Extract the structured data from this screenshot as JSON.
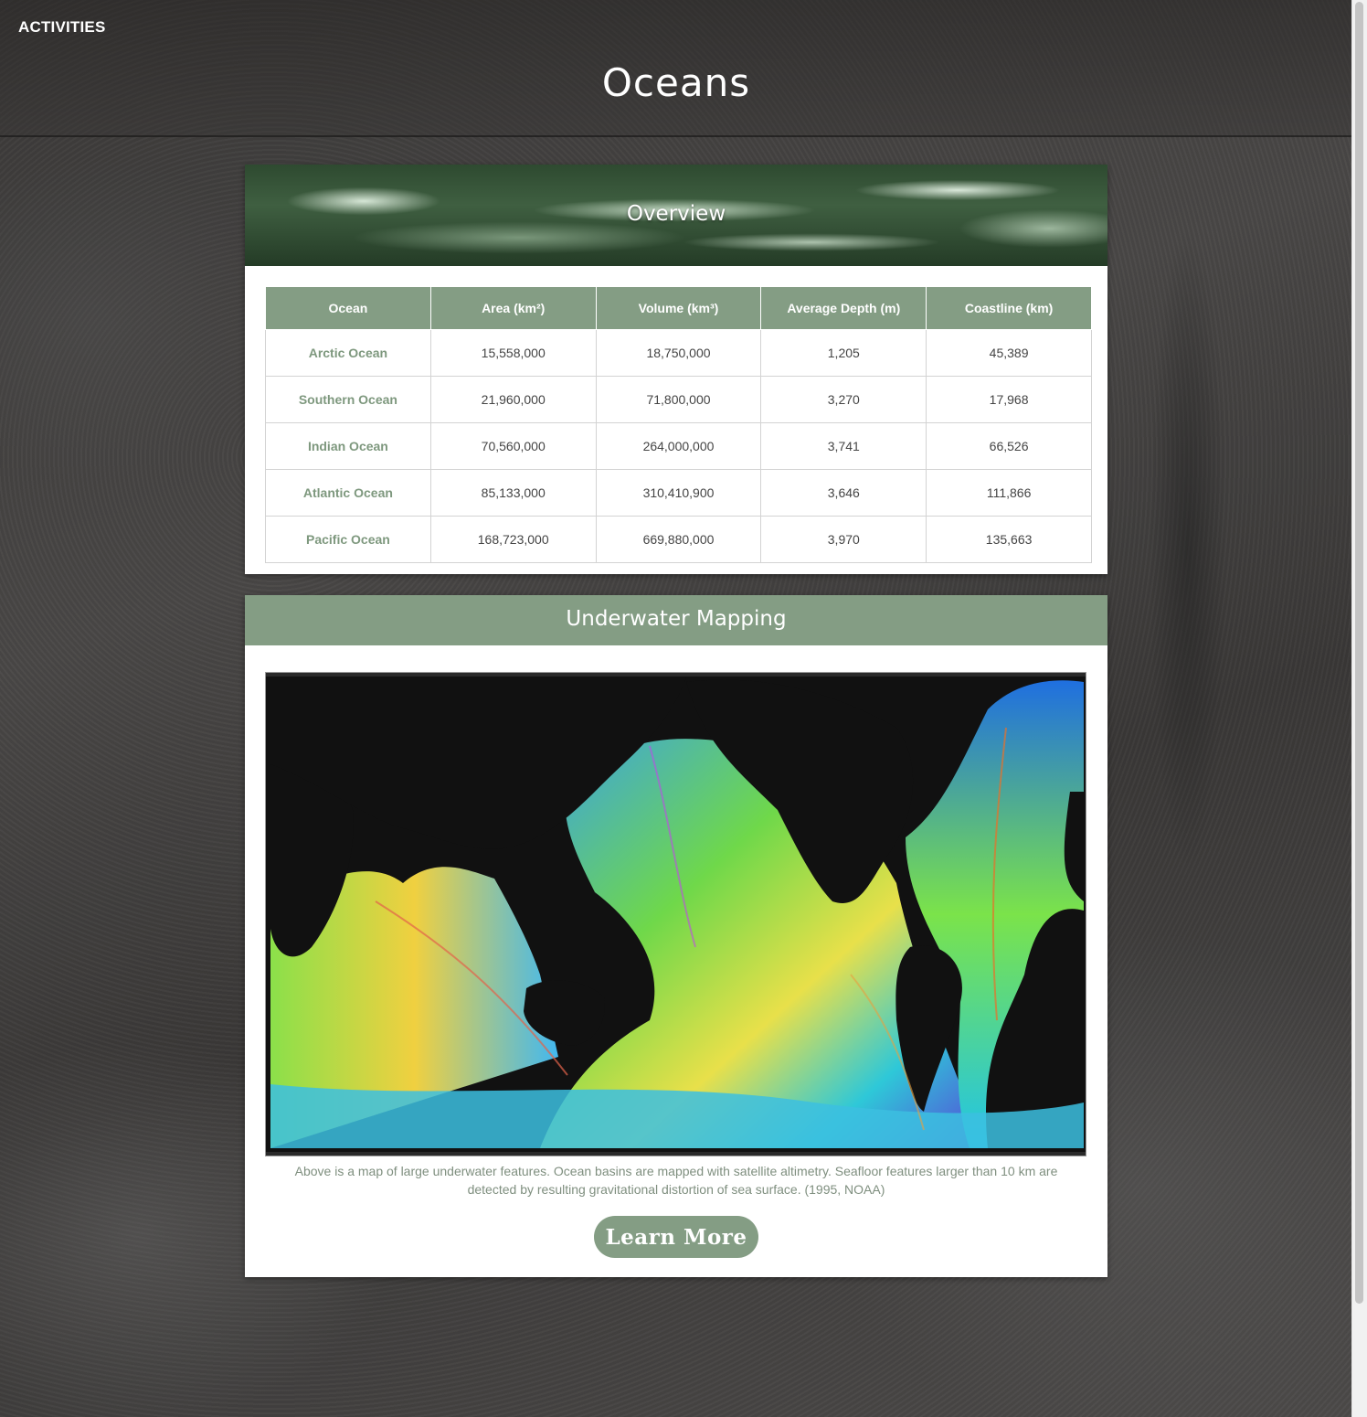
{
  "nav": {
    "activities_label": "ACTIVITIES"
  },
  "page": {
    "title": "Oceans"
  },
  "overview": {
    "title": "Overview",
    "columns": [
      "Ocean",
      "Area (km²)",
      "Volume (km³)",
      "Average Depth (m)",
      "Coastline (km)"
    ],
    "rows": [
      [
        "Arctic Ocean",
        "15,558,000",
        "18,750,000",
        "1,205",
        "45,389"
      ],
      [
        "Southern Ocean",
        "21,960,000",
        "71,800,000",
        "3,270",
        "17,968"
      ],
      [
        "Indian Ocean",
        "70,560,000",
        "264,000,000",
        "3,741",
        "66,526"
      ],
      [
        "Atlantic Ocean",
        "85,133,000",
        "310,410,900",
        "3,646",
        "111,866"
      ],
      [
        "Pacific Ocean",
        "168,723,000",
        "669,880,000",
        "3,970",
        "135,663"
      ]
    ]
  },
  "mapping": {
    "title": "Underwater Mapping",
    "caption": "Above is a map of large underwater features. Ocean basins are mapped with satellite altimetry. Seafloor features larger than 10 km are detected by resulting gravitational distortion of sea surface. (1995, NOAA)",
    "button_label": "Learn More"
  },
  "colors": {
    "accent": "#849d84",
    "ocean_name_text": "#7e987e",
    "card_background": "#ffffff",
    "map_land": "#111111"
  }
}
